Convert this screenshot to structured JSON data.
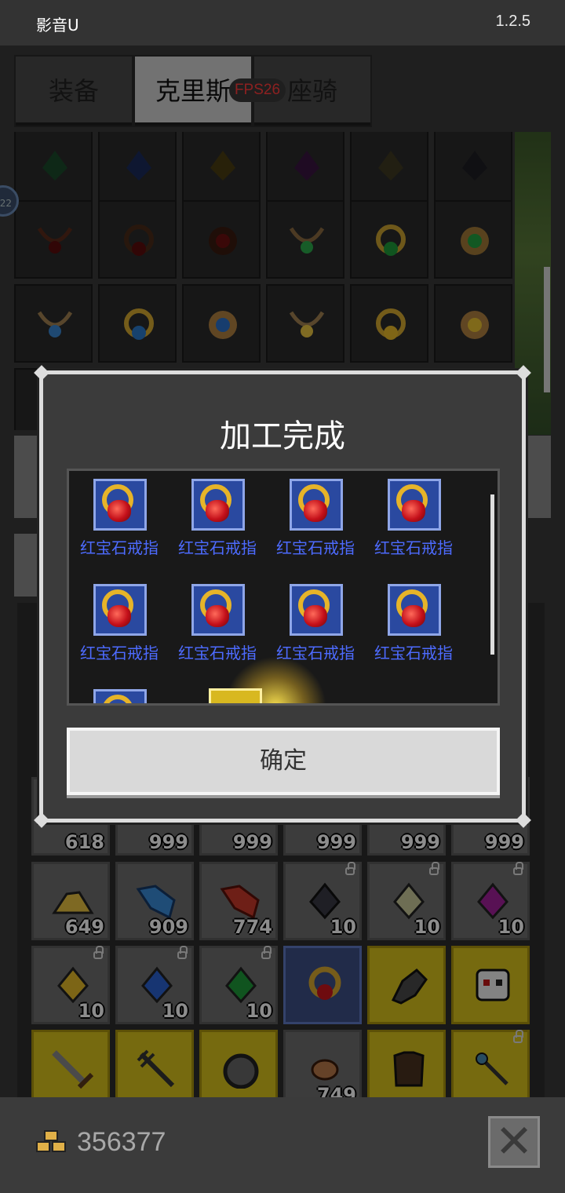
{
  "status": {
    "app_name": "影音U",
    "version": "1.2.5"
  },
  "tabs": [
    {
      "label": "装备",
      "active": false
    },
    {
      "label": "克里斯",
      "active": true
    },
    {
      "label": "座骑",
      "active": false
    }
  ],
  "fps_badge": "FPS26",
  "side_badge": "22",
  "top_grid_icons": [
    [
      "green-gem-icon",
      "blue-gem-icon",
      "yellow-gem-icon",
      "purple-gem-icon",
      "gold-gem-icon",
      "black-gem-icon"
    ],
    [
      "red-necklace-icon",
      "red-ring-icon",
      "red-amulet-icon",
      "green-necklace-icon",
      "green-ring-icon",
      "green-amulet-icon"
    ],
    [
      "blue-necklace-icon",
      "blue-ring-icon",
      "blue-amulet-icon",
      "yellow-necklace-icon",
      "yellow-ring-icon",
      "yellow-amulet-icon"
    ]
  ],
  "dialog": {
    "title": "加工完成",
    "items": [
      "红宝石戒指",
      "红宝石戒指",
      "红宝石戒指",
      "红宝石戒指",
      "红宝石戒指",
      "红宝石戒指",
      "红宝石戒指",
      "红宝石戒指"
    ],
    "confirm_label": "确定"
  },
  "inventory": {
    "row1": [
      "618",
      "999",
      "999",
      "999",
      "999",
      "999"
    ],
    "row2": [
      {
        "count": "649",
        "icon": "yellow-pile-icon",
        "locked": false
      },
      {
        "count": "909",
        "icon": "blue-cloth-icon",
        "locked": false
      },
      {
        "count": "774",
        "icon": "red-cloth-icon",
        "locked": false
      },
      {
        "count": "10",
        "icon": "black-gem-icon",
        "locked": true
      },
      {
        "count": "10",
        "icon": "pale-gem-icon",
        "locked": true
      },
      {
        "count": "10",
        "icon": "purple-gem-icon",
        "locked": true
      }
    ],
    "row3": [
      {
        "count": "10",
        "icon": "yellow-gem-icon",
        "locked": true
      },
      {
        "count": "10",
        "icon": "blue-gem-icon",
        "locked": true
      },
      {
        "count": "10",
        "icon": "green-gem-icon",
        "locked": true
      },
      {
        "count": "",
        "icon": "ruby-ring-icon",
        "locked": false
      },
      {
        "count": "",
        "icon": "gauntlet-icon",
        "locked": false
      },
      {
        "count": "",
        "icon": "skull-mask-icon",
        "locked": false
      }
    ],
    "row4": [
      {
        "count": "",
        "icon": "sword-icon",
        "locked": false
      },
      {
        "count": "",
        "icon": "trident-icon",
        "locked": false
      },
      {
        "count": "",
        "icon": "shield-icon",
        "locked": false
      },
      {
        "count": "749",
        "icon": "meat-icon",
        "locked": false
      },
      {
        "count": "",
        "icon": "armor-icon",
        "locked": false
      },
      {
        "count": "",
        "icon": "wand-icon",
        "locked": true
      }
    ]
  },
  "footer": {
    "gold_amount": "356377"
  }
}
